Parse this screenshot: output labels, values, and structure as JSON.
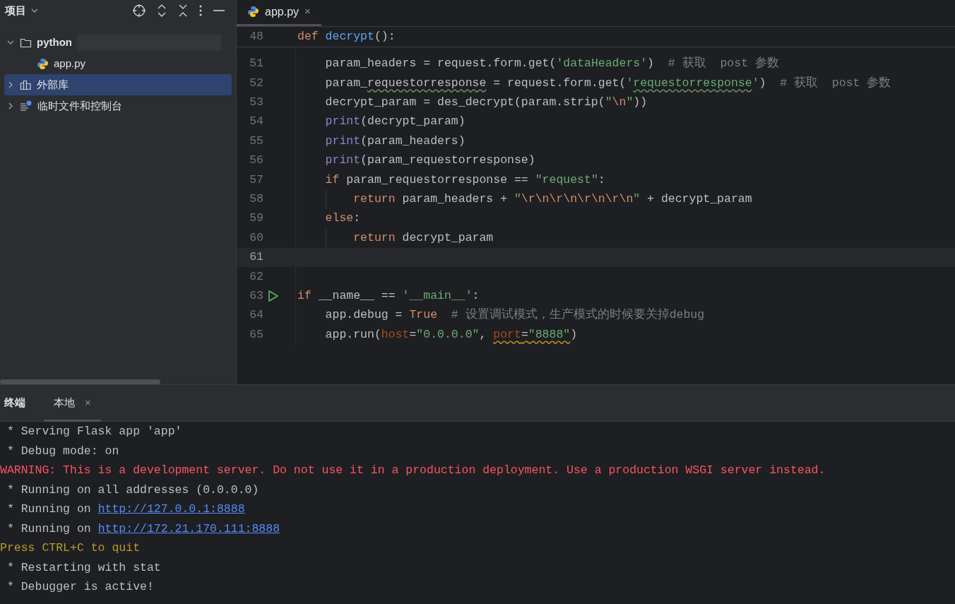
{
  "project_panel": {
    "title": "项目",
    "tree": [
      {
        "label": "python",
        "kind": "folder",
        "bold": true,
        "expanded": true,
        "selected": false,
        "children": [
          {
            "label": "app.py",
            "kind": "python",
            "bold": false,
            "selected": false
          }
        ]
      },
      {
        "label": "外部库",
        "kind": "library",
        "bold": false,
        "expanded": false,
        "selected": true
      },
      {
        "label": "临时文件和控制台",
        "kind": "scratch",
        "bold": false,
        "expanded": false,
        "selected": false
      }
    ]
  },
  "editor": {
    "tabs": [
      {
        "label": "app.py",
        "close": "×",
        "selected": true
      }
    ],
    "sticky_line": {
      "number": "48",
      "tokens": [
        {
          "text": "def ",
          "kind": "keyword"
        },
        {
          "text": "decrypt",
          "kind": "func"
        },
        {
          "text": "():",
          "kind": "plain"
        }
      ]
    },
    "lines": [
      {
        "number": "51",
        "current": false,
        "tokens": [
          {
            "text": "    param_headers = request.form.get(",
            "kind": "plain"
          },
          {
            "text": "'dataHeaders'",
            "kind": "string"
          },
          {
            "text": ")",
            "kind": "plain"
          },
          {
            "text": "  # 获取  post 参数",
            "kind": "comment"
          }
        ]
      },
      {
        "number": "52",
        "current": false,
        "tokens": [
          {
            "text": "    param_",
            "kind": "plain"
          },
          {
            "text": "requestorresponse",
            "kind": "plain_typo"
          },
          {
            "text": " = request.form.get(",
            "kind": "plain"
          },
          {
            "text": "'",
            "kind": "string"
          },
          {
            "text": "requestorresponse",
            "kind": "string_typo"
          },
          {
            "text": "'",
            "kind": "string"
          },
          {
            "text": ")",
            "kind": "plain"
          },
          {
            "text": "  # 获取  post 参数",
            "kind": "comment"
          }
        ]
      },
      {
        "number": "53",
        "current": false,
        "tokens": [
          {
            "text": "    decrypt_param = des_decrypt(param.strip(",
            "kind": "plain"
          },
          {
            "text": "\"",
            "kind": "string"
          },
          {
            "text": "\\n",
            "kind": "escape"
          },
          {
            "text": "\"",
            "kind": "string"
          },
          {
            "text": "))",
            "kind": "plain"
          }
        ]
      },
      {
        "number": "54",
        "current": false,
        "tokens": [
          {
            "text": "    print",
            "kind": "builtin"
          },
          {
            "text": "(decrypt_param)",
            "kind": "plain"
          }
        ]
      },
      {
        "number": "55",
        "current": false,
        "tokens": [
          {
            "text": "    print",
            "kind": "builtin"
          },
          {
            "text": "(param_headers)",
            "kind": "plain"
          }
        ]
      },
      {
        "number": "56",
        "current": false,
        "tokens": [
          {
            "text": "    print",
            "kind": "builtin"
          },
          {
            "text": "(param_requestorresponse)",
            "kind": "plain"
          }
        ]
      },
      {
        "number": "57",
        "current": false,
        "tokens": [
          {
            "text": "    if",
            "kind": "keyword"
          },
          {
            "text": " param_requestorresponse == ",
            "kind": "plain"
          },
          {
            "text": "\"request\"",
            "kind": "string"
          },
          {
            "text": ":",
            "kind": "plain"
          }
        ]
      },
      {
        "number": "58",
        "current": false,
        "tokens": [
          {
            "text": "        return",
            "kind": "keyword"
          },
          {
            "text": " param_headers + ",
            "kind": "plain"
          },
          {
            "text": "\"",
            "kind": "string"
          },
          {
            "text": "\\r\\n\\r\\n\\r\\n\\r\\n",
            "kind": "escape"
          },
          {
            "text": "\"",
            "kind": "string"
          },
          {
            "text": " + decrypt_param",
            "kind": "plain"
          }
        ]
      },
      {
        "number": "59",
        "current": false,
        "tokens": [
          {
            "text": "    else",
            "kind": "keyword"
          },
          {
            "text": ":",
            "kind": "plain"
          }
        ]
      },
      {
        "number": "60",
        "current": false,
        "tokens": [
          {
            "text": "        return",
            "kind": "keyword"
          },
          {
            "text": " decrypt_param",
            "kind": "plain"
          }
        ]
      },
      {
        "number": "61",
        "current": true
      },
      {
        "number": "62",
        "current": false
      },
      {
        "number": "63",
        "current": false,
        "run": true,
        "tokens": [
          {
            "text": "if",
            "kind": "keyword"
          },
          {
            "text": " __name__ == ",
            "kind": "plain"
          },
          {
            "text": "'__main__'",
            "kind": "string"
          },
          {
            "text": ":",
            "kind": "plain"
          }
        ]
      },
      {
        "number": "64",
        "current": false,
        "tokens": [
          {
            "text": "    app.debug = ",
            "kind": "plain"
          },
          {
            "text": "True",
            "kind": "keyword"
          },
          {
            "text": "  # 设置调试模式，生产模式的时候要关掉debug",
            "kind": "comment"
          }
        ]
      },
      {
        "number": "65",
        "current": false,
        "tokens": [
          {
            "text": "    app.run(",
            "kind": "plain"
          },
          {
            "text": "host",
            "kind": "kwarg"
          },
          {
            "text": "=",
            "kind": "plain"
          },
          {
            "text": "\"0.0.0.0\"",
            "kind": "string"
          },
          {
            "text": ", ",
            "kind": "plain"
          },
          {
            "text": "port",
            "kind": "kwarg_warning"
          },
          {
            "text": "=",
            "kind": "plain_warning"
          },
          {
            "text": "\"8888\"",
            "kind": "string_warning"
          },
          {
            "text": ")",
            "kind": "plain"
          }
        ]
      }
    ]
  },
  "terminal": {
    "title": "终端",
    "tabs": [
      {
        "label": "本地",
        "close": "×",
        "selected": true
      }
    ],
    "lines": [
      {
        "kind": "normal",
        "parts": [
          {
            "text": " * Serving Flask app 'app'",
            "link": false
          }
        ]
      },
      {
        "kind": "normal",
        "parts": [
          {
            "text": " * Debug mode: on",
            "link": false
          }
        ]
      },
      {
        "kind": "error",
        "parts": [
          {
            "text": "WARNING: This is a development server. Do not use it in a production deployment. Use a production WSGI server instead.",
            "link": false
          }
        ]
      },
      {
        "kind": "normal",
        "parts": [
          {
            "text": " * Running on all addresses (0.0.0.0)",
            "link": false
          }
        ]
      },
      {
        "kind": "normal",
        "parts": [
          {
            "text": " * Running on ",
            "link": false
          },
          {
            "text": "http://127.0.0.1:8888",
            "link": true
          }
        ]
      },
      {
        "kind": "normal",
        "parts": [
          {
            "text": " * Running on ",
            "link": false
          },
          {
            "text": "http://172.21.170.111:8888",
            "link": true
          }
        ]
      },
      {
        "kind": "hint",
        "parts": [
          {
            "text": "Press CTRL+C to quit",
            "link": false
          }
        ]
      },
      {
        "kind": "normal",
        "parts": [
          {
            "text": " * Restarting with stat",
            "link": false
          }
        ]
      },
      {
        "kind": "normal",
        "parts": [
          {
            "text": " * Debugger is active!",
            "link": false
          }
        ]
      }
    ]
  }
}
